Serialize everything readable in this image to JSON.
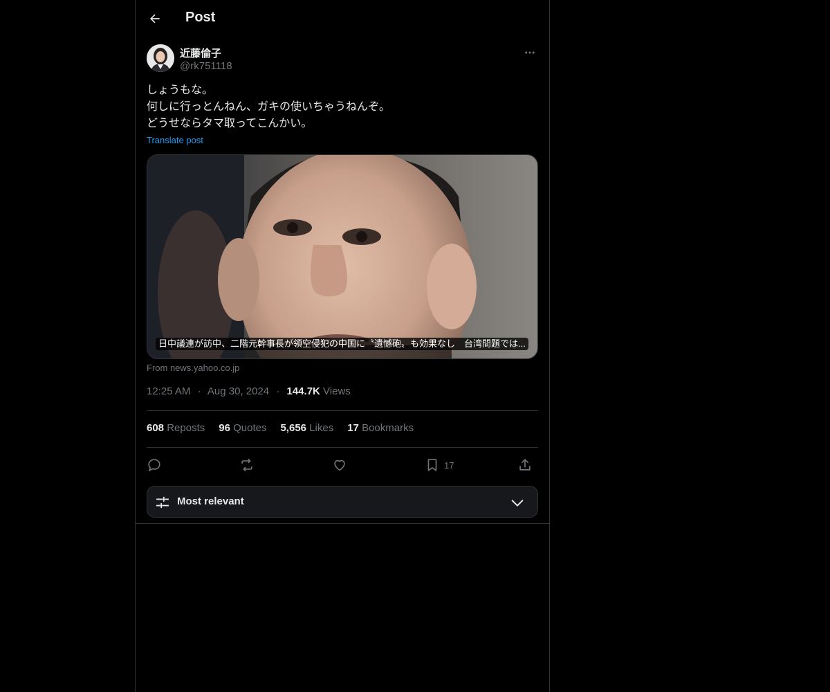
{
  "header": {
    "title": "Post"
  },
  "author": {
    "display_name": "近藤倫子",
    "handle": "@rk751118"
  },
  "post": {
    "lines": [
      "しょうもな。",
      "何しに行っとんねん、ガキの使いちゃうねんぞ。",
      "どうせならタマ取ってこんかい。"
    ],
    "translate_label": "Translate post"
  },
  "card": {
    "caption": "日中議連が訪中、二階元幹事長が領空侵犯の中国に〝遺憾砲〟も効果なし　台湾問題では...",
    "source": "From news.yahoo.co.jp"
  },
  "meta": {
    "time": "12:25 AM",
    "sep1": "·",
    "date": "Aug 30, 2024",
    "sep2": "·",
    "views_count": "144.7K",
    "views_label": "Views"
  },
  "stats": {
    "reposts_count": "608",
    "reposts_label": "Reposts",
    "quotes_count": "96",
    "quotes_label": "Quotes",
    "likes_count": "5,656",
    "likes_label": "Likes",
    "bookmarks_count": "17",
    "bookmarks_label": "Bookmarks"
  },
  "actions": {
    "bookmark_count": "17"
  },
  "sort": {
    "label": "Most relevant"
  },
  "icons": {
    "back": "arrow-left-icon",
    "more": "more-horizontal-icon",
    "reply": "reply-icon",
    "repost": "repost-icon",
    "like": "heart-icon",
    "bookmark": "bookmark-icon",
    "share": "share-icon",
    "filter": "sliders-icon",
    "dropdown": "chevron-down-icon"
  },
  "colors": {
    "background": "#000000",
    "text": "#e7e9ea",
    "muted": "#71767b",
    "link": "#1d9bf0",
    "border": "#2f3336"
  }
}
